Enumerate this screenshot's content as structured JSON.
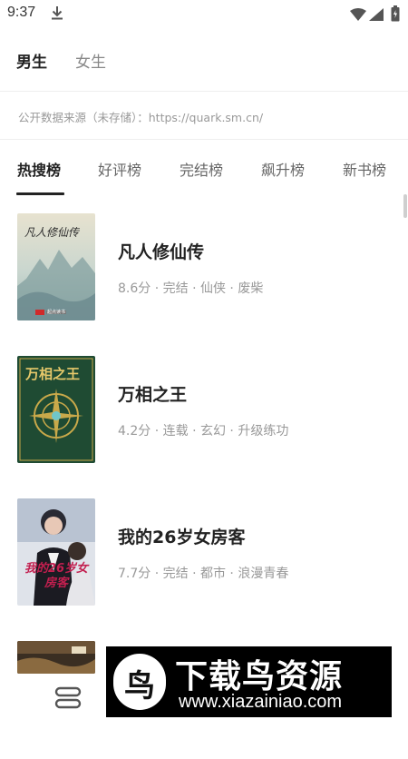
{
  "status_bar": {
    "time": "9:37"
  },
  "gender_tabs": [
    {
      "label": "男生",
      "active": true
    },
    {
      "label": "女生",
      "active": false
    }
  ],
  "source_note": "公开数据来源（未存储）：https://quark.sm.cn/",
  "rank_tabs": [
    {
      "label": "热搜榜",
      "active": true
    },
    {
      "label": "好评榜",
      "active": false
    },
    {
      "label": "完结榜",
      "active": false
    },
    {
      "label": "飙升榜",
      "active": false
    },
    {
      "label": "新书榜",
      "active": false
    }
  ],
  "books": [
    {
      "title": "凡人修仙传",
      "meta": "8.6分 · 完结 · 仙侠 · 废柴",
      "cover_text": "凡人修仙传",
      "cover_badge": "起点读书"
    },
    {
      "title": "万相之王",
      "meta": "4.2分 · 连载 · 玄幻 · 升级练功",
      "cover_text": "万相之王"
    },
    {
      "title": "我的26岁女房客",
      "meta": "7.7分 · 完结 · 都市 · 浪漫青春",
      "cover_text": "我的26岁女房客"
    }
  ],
  "watermark": {
    "logo_char": "鸟",
    "title": "下载鸟资源",
    "url": "www.xiazainiao.com"
  },
  "colors": {
    "accent_text": "#222222",
    "muted_text": "#999999",
    "divider": "#eeeeee"
  }
}
